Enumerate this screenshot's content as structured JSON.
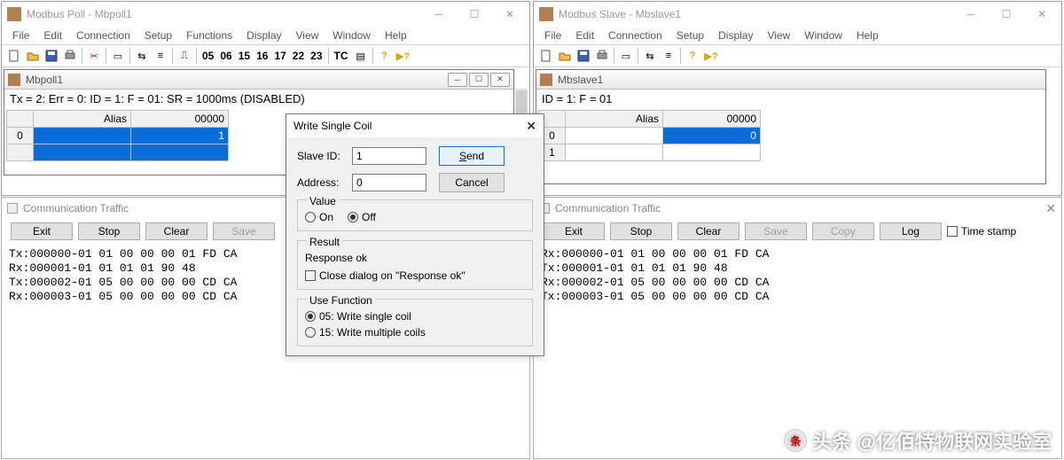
{
  "poll": {
    "title": "Modbus Poll - Mbpoll1",
    "menus": [
      "File",
      "Edit",
      "Connection",
      "Setup",
      "Functions",
      "Display",
      "View",
      "Window",
      "Help"
    ],
    "toolbar_fncodes": [
      "05",
      "06",
      "15",
      "16",
      "17",
      "22",
      "23"
    ],
    "toolbar_tc": "TC",
    "child_title": "Mbpoll1",
    "status": "Tx = 2: Err = 0: ID = 1: F = 01: SR = 1000ms  (DISABLED)",
    "cols": {
      "alias": "Alias",
      "val": "00000"
    },
    "rows": [
      {
        "idx": "0",
        "alias": "",
        "val": "1"
      }
    ],
    "traffic_title": "Communication Traffic",
    "traffic_btns": {
      "exit": "Exit",
      "stop": "Stop",
      "clear": "Clear",
      "save": "Save"
    },
    "traffic_lines": [
      "Tx:000000-01 01 00 00 00 01 FD CA",
      "Rx:000001-01 01 01 01 90 48",
      "Tx:000002-01 05 00 00 00 00 CD CA",
      "Rx:000003-01 05 00 00 00 00 CD CA"
    ]
  },
  "slave": {
    "title": "Modbus Slave - Mbslave1",
    "menus": [
      "File",
      "Edit",
      "Connection",
      "Setup",
      "Display",
      "View",
      "Window",
      "Help"
    ],
    "child_title": "Mbslave1",
    "status": "ID = 1: F = 01",
    "cols": {
      "alias": "Alias",
      "val": "00000"
    },
    "rows": [
      {
        "idx": "0",
        "alias": "",
        "val": "0",
        "sel": true
      },
      {
        "idx": "1",
        "alias": "",
        "val": ""
      }
    ],
    "traffic_title": "Communication Traffic",
    "traffic_btns": {
      "exit": "Exit",
      "stop": "Stop",
      "clear": "Clear",
      "save": "Save",
      "copy": "Copy",
      "log": "Log",
      "timestamp": "Time stamp"
    },
    "traffic_lines": [
      "Rx:000000-01 01 00 00 00 01 FD CA",
      "Tx:000001-01 01 01 01 90 48",
      "Rx:000002-01 05 00 00 00 00 CD CA",
      "Tx:000003-01 05 00 00 00 00 CD CA"
    ]
  },
  "dialog": {
    "title": "Write Single Coil",
    "slave_id_lbl": "Slave ID:",
    "slave_id": "1",
    "address_lbl": "Address:",
    "address": "0",
    "send": "Send",
    "cancel": "Cancel",
    "value_lbl": "Value",
    "on": "On",
    "off": "Off",
    "result_lbl": "Result",
    "result": "Response ok",
    "close_on_ok": "Close dialog on \"Response ok\"",
    "use_fn_lbl": "Use Function",
    "fn05": "05: Write single coil",
    "fn15": "15: Write multiple coils"
  },
  "watermark": "头条 @亿佰特物联网实验室"
}
